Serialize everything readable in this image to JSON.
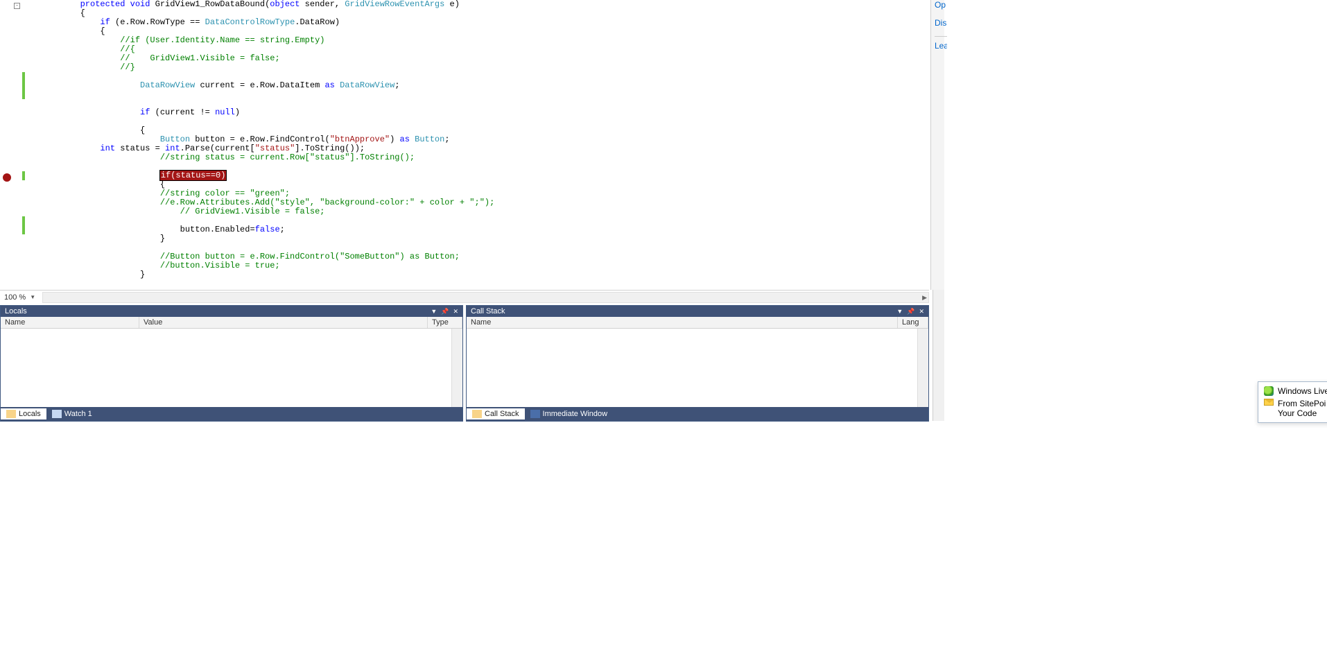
{
  "code": {
    "lines": [
      {
        "indent": 2,
        "tokens": [
          [
            "kw",
            "protected"
          ],
          [
            "",
            " "
          ],
          [
            "kw",
            "void"
          ],
          [
            "",
            " GridView1_RowDataBound("
          ],
          [
            "kw",
            "object"
          ],
          [
            "",
            " sender, "
          ],
          [
            "type",
            "GridViewRowEventArgs"
          ],
          [
            "",
            " e)"
          ]
        ]
      },
      {
        "indent": 2,
        "tokens": [
          [
            "",
            "{"
          ]
        ]
      },
      {
        "indent": 3,
        "tokens": [
          [
            "kw",
            "if"
          ],
          [
            "",
            " (e.Row.RowType == "
          ],
          [
            "type",
            "DataControlRowType"
          ],
          [
            "",
            ".DataRow)"
          ]
        ]
      },
      {
        "indent": 3,
        "tokens": [
          [
            "",
            "{"
          ]
        ]
      },
      {
        "indent": 4,
        "tokens": [
          [
            "cmt",
            "//if (User.Identity.Name == string.Empty)"
          ]
        ]
      },
      {
        "indent": 4,
        "tokens": [
          [
            "cmt",
            "//{"
          ]
        ]
      },
      {
        "indent": 4,
        "tokens": [
          [
            "cmt",
            "//    GridView1.Visible = false;"
          ]
        ]
      },
      {
        "indent": 4,
        "tokens": [
          [
            "cmt",
            "//}"
          ]
        ]
      },
      {
        "indent": 0,
        "tokens": [
          [
            "",
            ""
          ]
        ]
      },
      {
        "indent": 5,
        "tokens": [
          [
            "type",
            "DataRowView"
          ],
          [
            "",
            " current = e.Row.DataItem "
          ],
          [
            "kw",
            "as"
          ],
          [
            "",
            " "
          ],
          [
            "type",
            "DataRowView"
          ],
          [
            "",
            ";"
          ]
        ]
      },
      {
        "indent": 0,
        "tokens": [
          [
            "",
            ""
          ]
        ]
      },
      {
        "indent": 0,
        "tokens": [
          [
            "",
            ""
          ]
        ]
      },
      {
        "indent": 5,
        "tokens": [
          [
            "kw",
            "if"
          ],
          [
            "",
            " (current != "
          ],
          [
            "kw",
            "null"
          ],
          [
            "",
            ")"
          ]
        ]
      },
      {
        "indent": 0,
        "tokens": [
          [
            "",
            ""
          ]
        ]
      },
      {
        "indent": 5,
        "tokens": [
          [
            "",
            "{"
          ]
        ]
      },
      {
        "indent": 6,
        "tokens": [
          [
            "type",
            "Button"
          ],
          [
            "",
            " button = e.Row.FindControl("
          ],
          [
            "str",
            "\"btnApprove\""
          ],
          [
            "",
            ") "
          ],
          [
            "kw",
            "as"
          ],
          [
            "",
            " "
          ],
          [
            "type",
            "Button"
          ],
          [
            "",
            ";"
          ]
        ]
      },
      {
        "indent": 5,
        "tokens": [
          [
            "kw",
            "int"
          ],
          [
            "",
            " status = "
          ],
          [
            "kw",
            "int"
          ],
          [
            "",
            ".Parse(current["
          ],
          [
            "str",
            "\"status\""
          ],
          [
            "",
            "].ToString());"
          ]
        ],
        "outdent": true
      },
      {
        "indent": 6,
        "tokens": [
          [
            "cmt",
            "//string status = current.Row[\"status\"].ToString();"
          ]
        ]
      },
      {
        "indent": 0,
        "tokens": [
          [
            "",
            ""
          ]
        ]
      },
      {
        "indent": 6,
        "tokens": [],
        "highlighted": "if(status==0)",
        "breakpoint": true
      },
      {
        "indent": 6,
        "tokens": [
          [
            "",
            "{"
          ]
        ]
      },
      {
        "indent": 6,
        "tokens": [
          [
            "cmt",
            "//string color == \"green\";"
          ]
        ]
      },
      {
        "indent": 6,
        "tokens": [
          [
            "cmt",
            "//e.Row.Attributes.Add(\"style\", \"background-color:\" + color + \";\");"
          ]
        ]
      },
      {
        "indent": 7,
        "tokens": [
          [
            "cmt",
            "// GridView1.Visible = false;"
          ]
        ]
      },
      {
        "indent": 0,
        "tokens": [
          [
            "",
            ""
          ]
        ]
      },
      {
        "indent": 7,
        "tokens": [
          [
            "",
            "button.Enabled="
          ],
          [
            "kw",
            "false"
          ],
          [
            "",
            ";"
          ]
        ]
      },
      {
        "indent": 6,
        "tokens": [
          [
            "",
            "}"
          ]
        ]
      },
      {
        "indent": 0,
        "tokens": [
          [
            "",
            ""
          ]
        ]
      },
      {
        "indent": 6,
        "tokens": [
          [
            "cmt",
            "//Button button = e.Row.FindControl(\"SomeButton\") as Button;"
          ]
        ]
      },
      {
        "indent": 6,
        "tokens": [
          [
            "cmt",
            "//button.Visible = true;"
          ]
        ]
      },
      {
        "indent": 5,
        "tokens": [
          [
            "",
            "}"
          ]
        ]
      }
    ]
  },
  "zoom": "100 %",
  "panels": {
    "locals": {
      "title": "Locals",
      "columns": [
        "Name",
        "Value",
        "Type"
      ]
    },
    "callstack": {
      "title": "Call Stack",
      "columns": [
        "Name",
        "Lang"
      ]
    }
  },
  "left_tabs": [
    {
      "label": "Locals",
      "active": true,
      "icon_bg": "#f8d48a"
    },
    {
      "label": "Watch 1",
      "active": false,
      "icon_bg": "#c6d8f2"
    }
  ],
  "right_tabs": [
    {
      "label": "Call Stack",
      "active": true,
      "icon_bg": "#f8d48a"
    },
    {
      "label": "Immediate Window",
      "active": false,
      "icon_bg": "#4a6ea9"
    }
  ],
  "sidelinks": [
    "Op",
    "Dis",
    "Lea"
  ],
  "notification": {
    "title": "Windows Live Me",
    "line1": "From SitePoi",
    "line2": "Your Code"
  }
}
